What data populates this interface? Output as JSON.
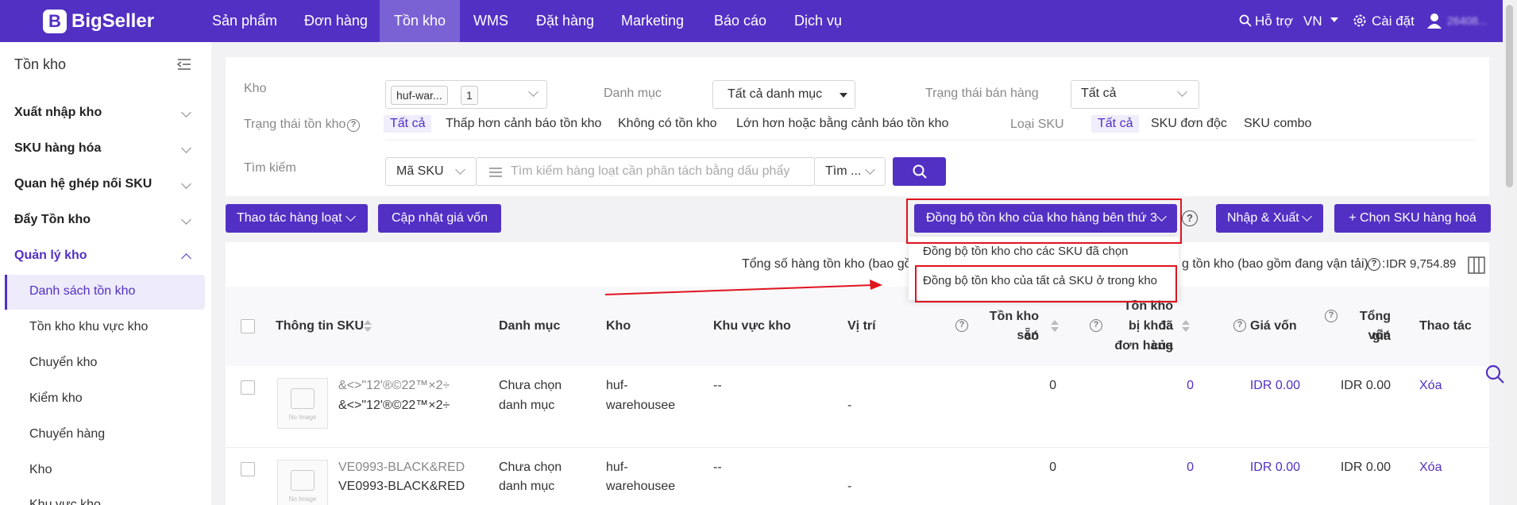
{
  "brand": "BigSeller",
  "nav": [
    "Sản phẩm",
    "Đơn hàng",
    "Tồn kho",
    "WMS",
    "Đặt hàng",
    "Marketing",
    "Báo cáo",
    "Dịch vụ"
  ],
  "topright": {
    "support": "Hỗ trợ",
    "region": "VN",
    "settings": "Cài đặt",
    "user": "26408..."
  },
  "sidebar": {
    "title": "Tồn kho",
    "sections": [
      "Xuất nhập kho",
      "SKU hàng hóa",
      "Quan hệ ghép nối SKU",
      "Đẩy Tồn kho",
      "Quản lý kho"
    ],
    "items": [
      "Danh sách tồn kho",
      "Tồn kho khu vực kho",
      "Chuyển kho",
      "Kiểm kho",
      "Chuyển hàng",
      "Kho",
      "Khu vực kho"
    ]
  },
  "filters": {
    "warehouse_label": "Kho",
    "warehouse_tag": "huf-war...",
    "warehouse_count": "1",
    "category_label": "Danh mục",
    "category_value": "Tất cả danh mục",
    "sale_status_label": "Trạng thái bán hàng",
    "sale_status_value": "Tất cả",
    "stock_status_label": "Trạng thái tồn kho",
    "stock_status_options": [
      "Tất cả",
      "Thấp hơn cảnh báo tồn kho",
      "Không có tồn kho",
      "Lớn hơn hoặc bằng cảnh báo tồn kho"
    ],
    "sku_type_label": "Loại SKU",
    "sku_type_options": [
      "Tất cả",
      "SKU đơn độc",
      "SKU combo"
    ],
    "search_label": "Tìm kiếm",
    "search_field": "Mã SKU",
    "search_placeholder": "Tìm kiếm hàng loạt cần phân tách bằng dấu phẩy",
    "search_mode": "Tìm ..."
  },
  "toolbar": {
    "bulk": "Thao tác hàng loạt",
    "update_cost": "Cập nhật giá vốn",
    "sync_3rd": "Đồng bộ tồn kho của kho hàng bên thứ 3",
    "import_export": "Nhập & Xuất",
    "choose_sku": "+ Chọn SKU hàng hoá"
  },
  "dropdown": [
    "Đồng bộ tồn kho cho các SKU đã chọn",
    "Đồng bộ tồn kho của tất cả SKU ở trong kho"
  ],
  "summary": {
    "left": "Tổng số hàng tồn kho (bao gồm",
    "right": "g tồn kho (bao gồm đang vận tải)",
    "value": "IDR 9,754.89"
  },
  "columns": {
    "sku_info": "Thông tin SKU",
    "category": "Danh mục",
    "warehouse": "Kho",
    "zone": "Khu vực kho",
    "location": "Vị trí",
    "available_1": "Tồn kho có",
    "available_2": "sẵn",
    "locked_1": "Tồn kho đã",
    "locked_2": "bị khóa của",
    "locked_3": "đơn hàng",
    "cost": "Giá vốn",
    "total_cost_1": "Tổng giá",
    "total_cost_2": "vốn",
    "action": "Thao tác"
  },
  "rows": [
    {
      "sku_a": "&<>\"12'®©22™×2÷",
      "sku_b": "&<>\"12'®©22™×2÷",
      "cat_1": "Chưa chọn",
      "cat_2": "danh mục",
      "wh_1": "huf-",
      "wh_2": "warehousee",
      "zone": "--",
      "loc": "-",
      "available": "0",
      "locked": "0",
      "cost": "IDR 0.00",
      "total": "IDR 0.00",
      "action": "Xóa"
    },
    {
      "sku_a": "VE0993-BLACK&RED",
      "sku_b": "VE0993-BLACK&RED",
      "cat_1": "Chưa chọn",
      "cat_2": "danh mục",
      "wh_1": "huf-",
      "wh_2": "warehousee",
      "zone": "--",
      "loc": "-",
      "available": "0",
      "locked": "0",
      "cost": "IDR 0.00",
      "total": "IDR 0.00",
      "action": "Xóa"
    }
  ],
  "no_image": "No Image",
  "colors": {
    "primary": "#5230c4",
    "annotation": "#e0141e"
  }
}
